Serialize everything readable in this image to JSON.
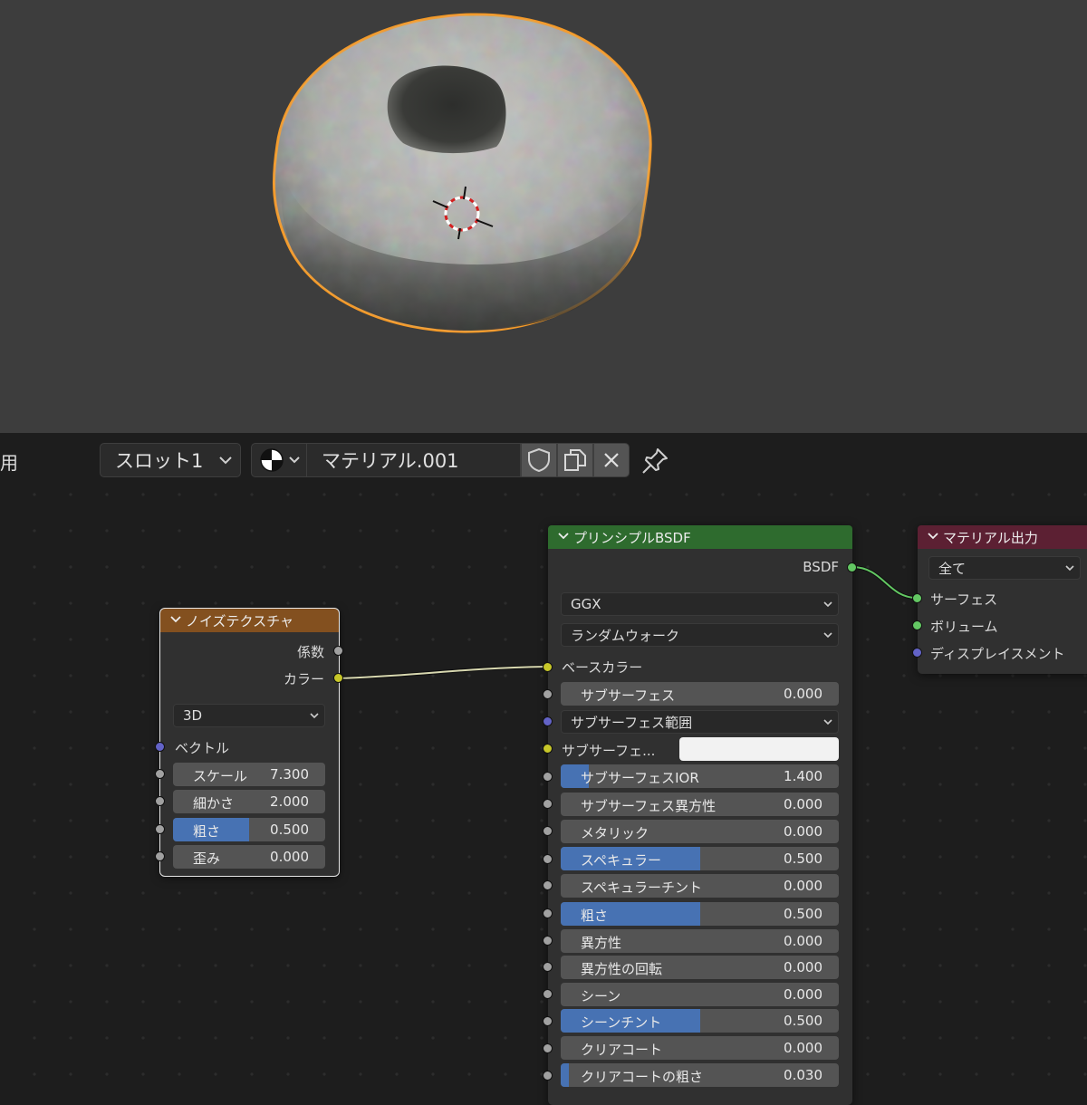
{
  "header": {
    "cut_label": "用",
    "slot": "スロット1",
    "material_name": "マテリアル.001",
    "icons": [
      "shading-sphere-icon",
      "fake-user-shield-icon",
      "duplicate-icon",
      "close-icon",
      "pin-icon"
    ]
  },
  "noise_node": {
    "title": "ノイズテクスチャ",
    "outputs": [
      "係数",
      "カラー"
    ],
    "dimension": "3D",
    "vector_label": "ベクトル",
    "fields": [
      {
        "label": "スケール",
        "value": "7.300"
      },
      {
        "label": "細かさ",
        "value": "2.000"
      },
      {
        "label": "粗さ",
        "value": "0.500",
        "fill": 0.5
      },
      {
        "label": "歪み",
        "value": "0.000"
      }
    ]
  },
  "bsdf_node": {
    "title": "プリンシプルBSDF",
    "output": "BSDF",
    "distribution": "GGX",
    "subsurface_method": "ランダムウォーク",
    "base_color_label": "ベースカラー",
    "subsurface_label": "サブサーフェス",
    "subsurface_value": "0.000",
    "subsurface_radius": "サブサーフェス範囲",
    "subsurface_color_label": "サブサーフェ...",
    "fields": [
      {
        "label": "サブサーフェスIOR",
        "value": "1.400",
        "fill": 0.1
      },
      {
        "label": "サブサーフェス異方性",
        "value": "0.000"
      },
      {
        "label": "メタリック",
        "value": "0.000"
      },
      {
        "label": "スペキュラー",
        "value": "0.500",
        "fill": 0.5
      },
      {
        "label": "スペキュラーチント",
        "value": "0.000"
      },
      {
        "label": "粗さ",
        "value": "0.500",
        "fill": 0.5
      },
      {
        "label": "異方性",
        "value": "0.000"
      },
      {
        "label": "異方性の回転",
        "value": "0.000"
      },
      {
        "label": "シーン",
        "value": "0.000"
      },
      {
        "label": "シーンチント",
        "value": "0.500",
        "fill": 0.5
      },
      {
        "label": "クリアコート",
        "value": "0.000"
      },
      {
        "label": "クリアコートの粗さ",
        "value": "0.030",
        "fill": 0.03
      }
    ]
  },
  "output_node": {
    "title": "マテリアル出力",
    "target": "全て",
    "inputs": [
      "サーフェス",
      "ボリューム",
      "ディスプレイスメント"
    ]
  },
  "colors": {
    "noise_header": "#83501f",
    "bsdf_header": "#2e6b2e",
    "output_header": "#5c2033",
    "selection_outline": "#f59a27",
    "field_fill": "#4772b3"
  }
}
